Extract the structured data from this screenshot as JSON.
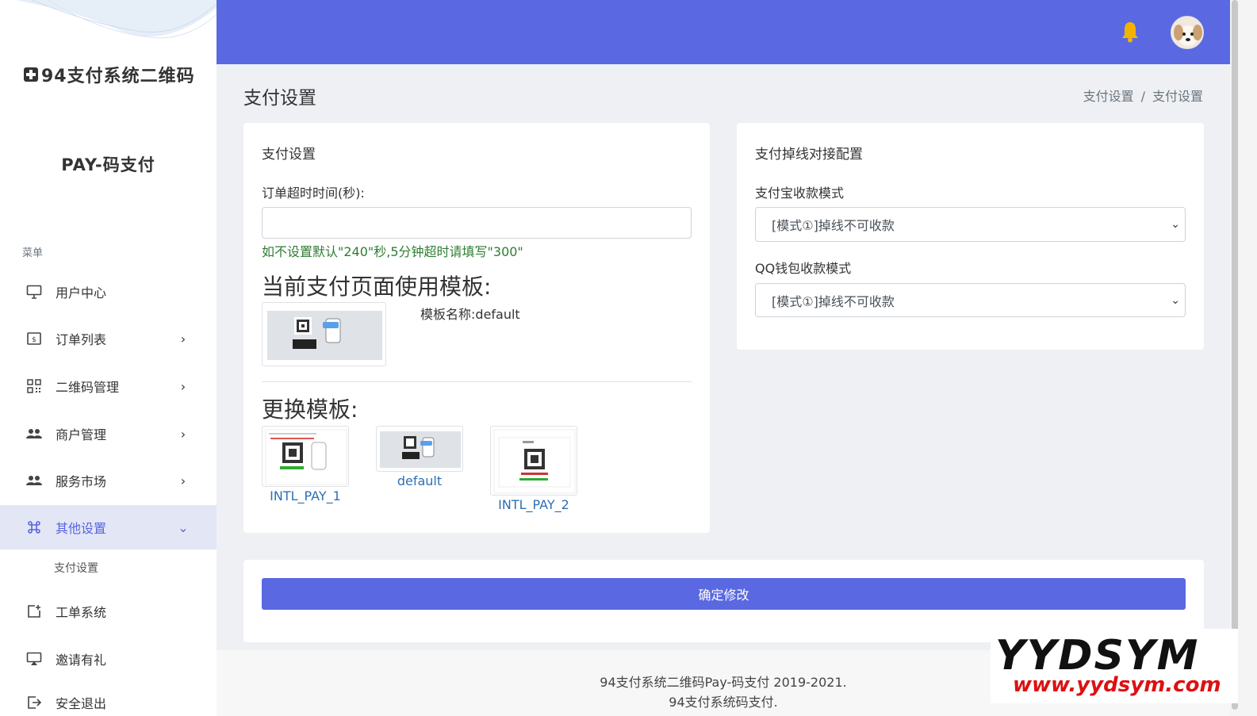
{
  "sidebar": {
    "brand": "94支付系统二维码",
    "subbrand": "PAY-码支付",
    "menu_header": "菜单",
    "items": [
      {
        "label": "用户中心",
        "icon": "monitor-icon"
      },
      {
        "label": "订单列表",
        "icon": "dollar-box-icon"
      },
      {
        "label": "二维码管理",
        "icon": "qrcode-icon"
      },
      {
        "label": "商户管理",
        "icon": "users-icon"
      },
      {
        "label": "服务市场",
        "icon": "users-icon"
      },
      {
        "label": "其他设置",
        "icon": "command-icon"
      },
      {
        "label": "工单系统",
        "icon": "add-ticket-icon"
      },
      {
        "label": "邀请有礼",
        "icon": "cast-icon"
      },
      {
        "label": "安全退出",
        "icon": "logout-icon"
      }
    ],
    "submenu": {
      "label": "支付设置"
    }
  },
  "header": {
    "page_title": "支付设置",
    "breadcrumb": [
      "支付设置",
      "支付设置"
    ]
  },
  "settings_card": {
    "title": "支付设置",
    "timeout_label": "订单超时时间(秒):",
    "timeout_value": "",
    "timeout_help": "如不设置默认\"240\"秒,5分钟超时请填写\"300\"",
    "current_template_heading": "当前支付页面使用模板:",
    "template_name_label": "模板名称:",
    "template_name_value": "default",
    "change_template_heading": "更换模板:",
    "templates": [
      "INTL_PAY_1",
      "default",
      "INTL_PAY_2"
    ]
  },
  "offline_card": {
    "title": "支付掉线对接配置",
    "alipay_label": "支付宝收款模式",
    "alipay_value": "[模式①]掉线不可收款",
    "qq_label": "QQ钱包收款模式",
    "qq_value": "[模式①]掉线不可收款"
  },
  "actions": {
    "submit_label": "确定修改"
  },
  "footer": {
    "line1": "94支付系统二维码Pay-码支付 2019-2021.",
    "line2": "94支付系统码支付."
  },
  "watermark": {
    "title": "YYDSYM",
    "url": "www.yydsym.com"
  },
  "colors": {
    "accent": "#5a68e2",
    "help_text": "#2e7d32",
    "link": "#2d6fb5",
    "bell": "#f5b301"
  }
}
